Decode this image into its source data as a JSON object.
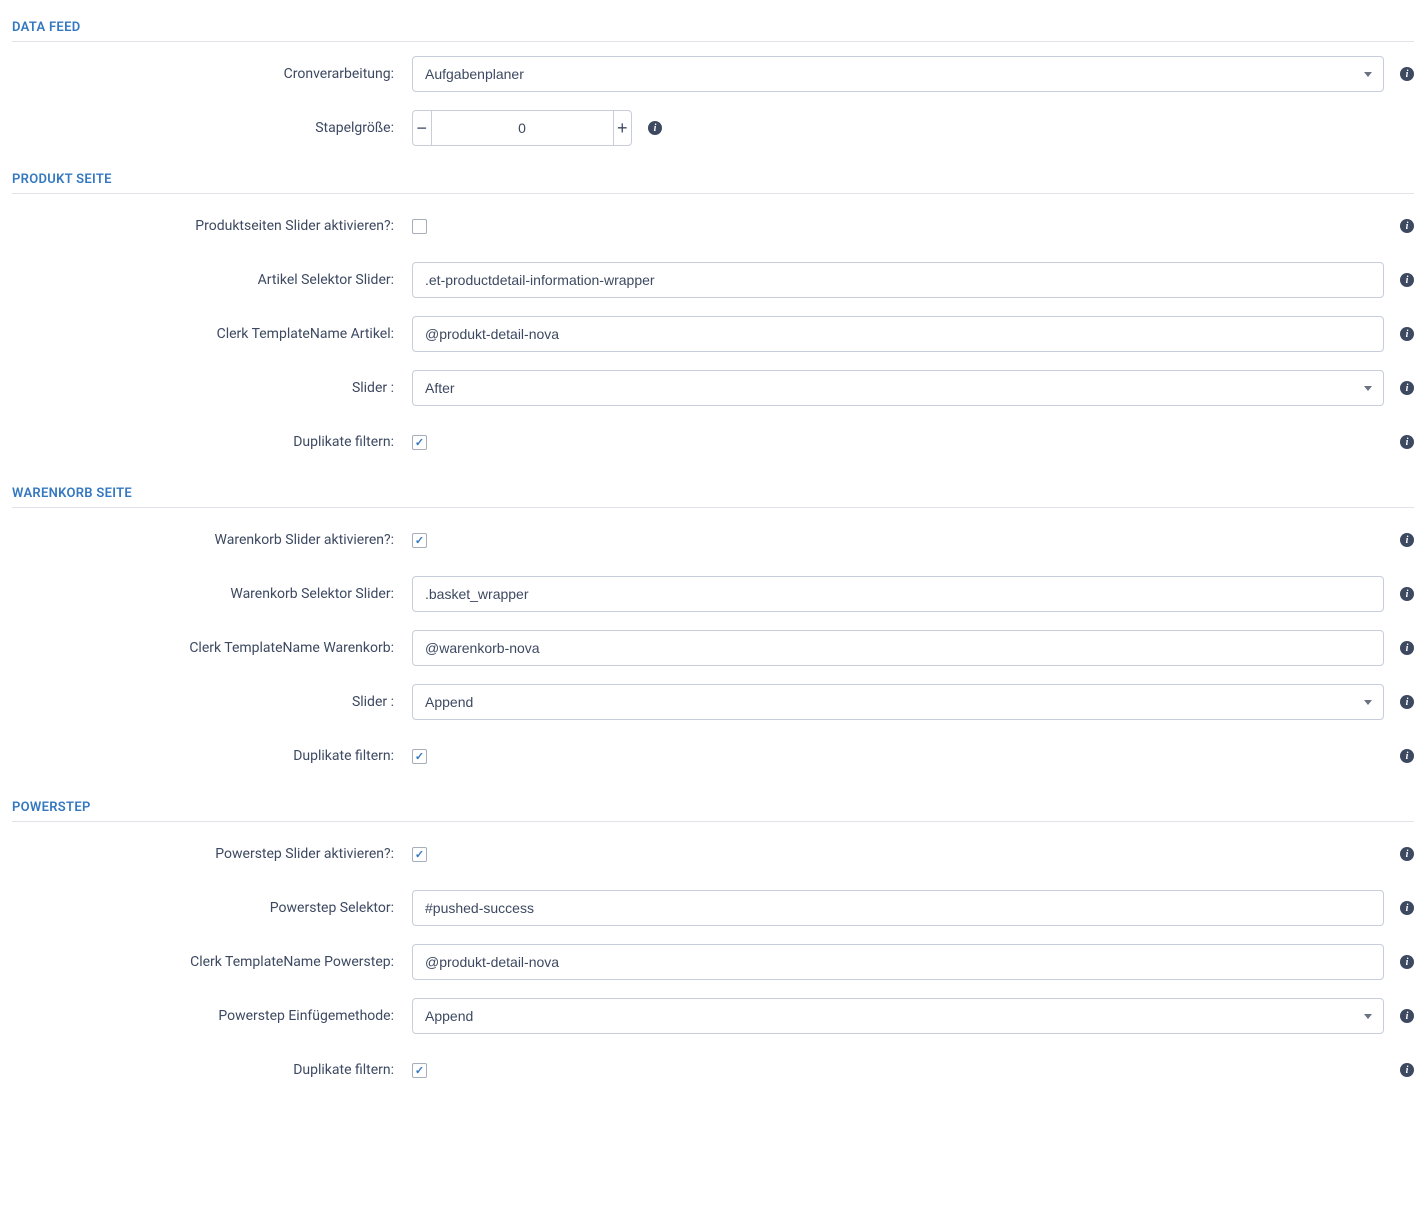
{
  "sections": {
    "dataFeed": {
      "title": "DATA FEED",
      "cronLabel": "Cronverarbeitung:",
      "cronValue": "Aufgabenplaner",
      "batchLabel": "Stapelgröße:",
      "batchValue": "0"
    },
    "productPage": {
      "title": "PRODUKT SEITE",
      "activateLabel": "Produktseiten Slider aktivieren?:",
      "activateChecked": false,
      "selectorLabel": "Artikel Selektor Slider:",
      "selectorValue": ".et-productdetail-information-wrapper",
      "templateLabel": "Clerk TemplateName Artikel:",
      "templateValue": "@produkt-detail-nova",
      "sliderLabel": "Slider :",
      "sliderValue": "After",
      "filterLabel": "Duplikate filtern:",
      "filterChecked": true
    },
    "cartPage": {
      "title": "WARENKORB SEITE",
      "activateLabel": "Warenkorb Slider aktivieren?:",
      "activateChecked": true,
      "selectorLabel": "Warenkorb Selektor Slider:",
      "selectorValue": ".basket_wrapper",
      "templateLabel": "Clerk TemplateName Warenkorb:",
      "templateValue": "@warenkorb-nova",
      "sliderLabel": "Slider :",
      "sliderValue": "Append",
      "filterLabel": "Duplikate filtern:",
      "filterChecked": true
    },
    "powerstep": {
      "title": "POWERSTEP",
      "activateLabel": "Powerstep Slider aktivieren?:",
      "activateChecked": true,
      "selectorLabel": "Powerstep Selektor:",
      "selectorValue": "#pushed-success",
      "templateLabel": "Clerk TemplateName Powerstep:",
      "templateValue": "@produkt-detail-nova",
      "insertLabel": "Powerstep Einfügemethode:",
      "insertValue": "Append",
      "filterLabel": "Duplikate filtern:",
      "filterChecked": true
    }
  }
}
